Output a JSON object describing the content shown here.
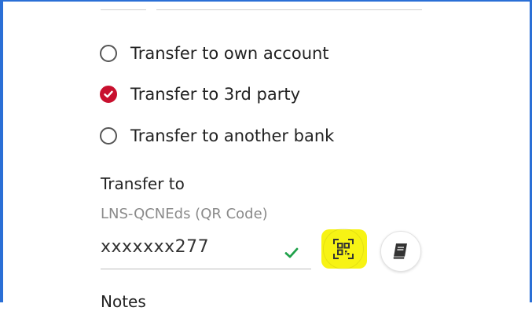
{
  "transfer_type": {
    "options": [
      {
        "label": "Transfer to own account",
        "checked": false
      },
      {
        "label": "Transfer to 3rd party",
        "checked": true
      },
      {
        "label": "Transfer to another bank",
        "checked": false
      }
    ]
  },
  "transfer_to": {
    "label": "Transfer to",
    "helper": "LNS-QCNEds (QR Code)",
    "value": "xxxxxxx277"
  },
  "buttons": {
    "qr_icon": "qr-scan-icon",
    "book_icon": "address-book-icon"
  },
  "next_section_label": "Notes",
  "colors": {
    "accent_red": "#c8102e",
    "valid_green": "#1fa14a",
    "highlight_yellow": "#f6f200",
    "frame_blue": "#2a6fd6"
  }
}
